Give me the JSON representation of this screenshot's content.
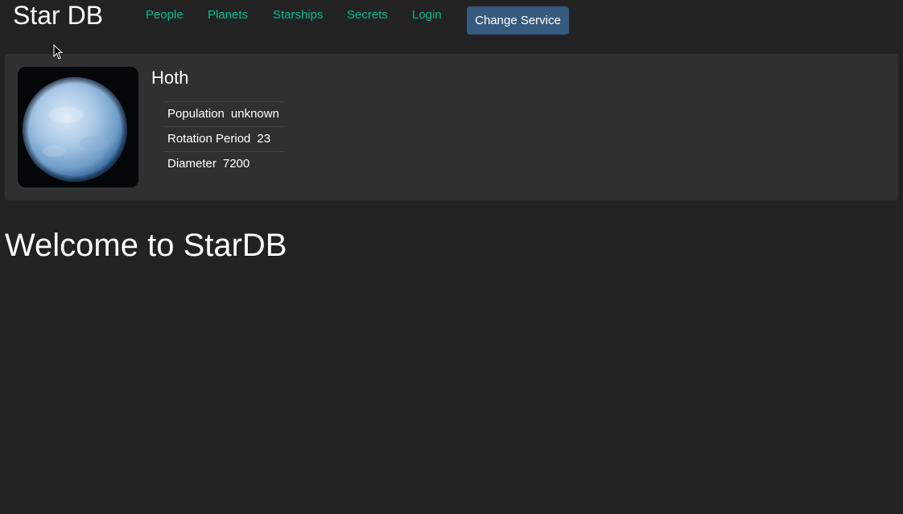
{
  "header": {
    "brand": "Star DB",
    "nav": [
      {
        "label": "People"
      },
      {
        "label": "Planets"
      },
      {
        "label": "Starships"
      },
      {
        "label": "Secrets"
      },
      {
        "label": "Login"
      }
    ],
    "change_service_label": "Change Service"
  },
  "planet": {
    "name": "Hoth",
    "details": [
      {
        "term": "Population",
        "value": "unknown"
      },
      {
        "term": "Rotation Period",
        "value": "23"
      },
      {
        "term": "Diameter",
        "value": "7200"
      }
    ]
  },
  "main": {
    "welcome": "Welcome to StarDB"
  },
  "colors": {
    "background": "#222222",
    "card": "#303030",
    "link": "#00bc8c",
    "button": "#375a7f"
  }
}
